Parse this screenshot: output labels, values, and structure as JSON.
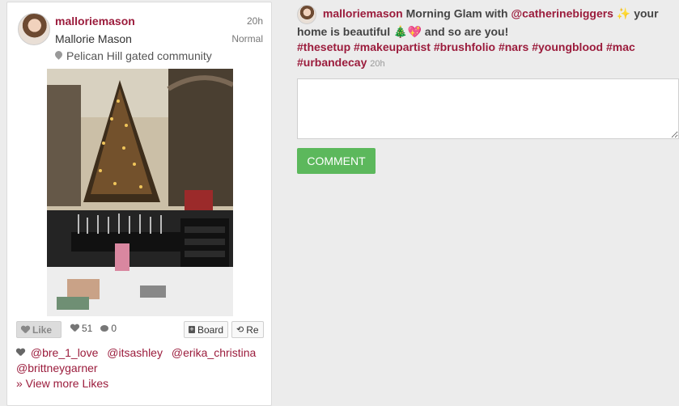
{
  "post": {
    "username": "malloriemason",
    "full_name": "Mallorie Mason",
    "time": "20h",
    "filter": "Normal",
    "location": "Pelican Hill gated community"
  },
  "actions": {
    "like_label": "Like",
    "like_count": "51",
    "comment_count": "0",
    "board_label": "Board",
    "repost_label": "Re"
  },
  "likers": [
    "@bre_1_love",
    "@itsashley",
    "@erika_christina",
    "@brittneygarner"
  ],
  "view_more": "» View more Likes",
  "caption": {
    "username": "malloriemason",
    "text_1": "Morning Glam with",
    "mention": "@catherinebiggers",
    "emoji_1": "✨",
    "text_2": "your home is beautiful",
    "emoji_2": "🎄💖",
    "text_3": "and so are you!",
    "tags": [
      "#thesetup",
      "#makeupartist",
      "#brushfolio",
      "#nars",
      "#youngblood",
      "#mac",
      "#urbandecay"
    ],
    "time": "20h"
  },
  "comment": {
    "placeholder": "",
    "button_label": "COMMENT"
  },
  "colors": {
    "brand": "#9b1c3c",
    "button_green": "#5cb85c",
    "background": "#ececec"
  }
}
